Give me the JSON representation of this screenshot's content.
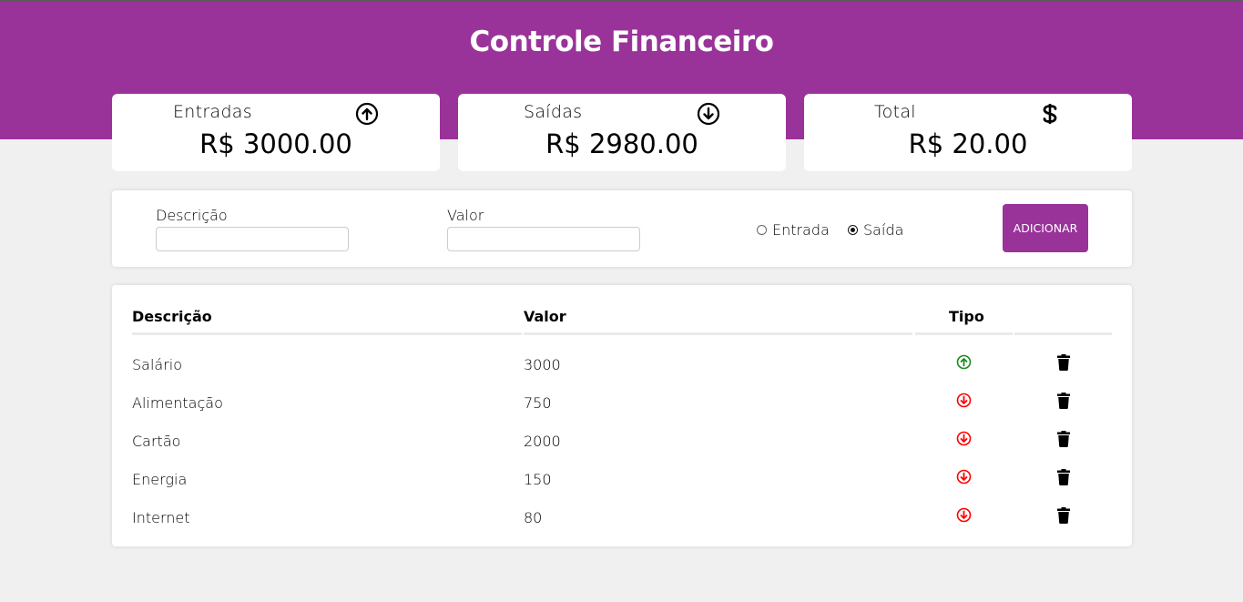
{
  "app": {
    "title": "Controle Financeiro"
  },
  "summary": {
    "entradas": {
      "label": "Entradas",
      "value": "R$ 3000.00",
      "icon": "arrow-up-circle-icon"
    },
    "saidas": {
      "label": "Saídas",
      "value": "R$ 2980.00",
      "icon": "arrow-down-circle-icon"
    },
    "total": {
      "label": "Total",
      "value": "R$ 20.00",
      "icon": "dollar-icon"
    }
  },
  "form": {
    "descricao_label": "Descrição",
    "descricao_value": "",
    "valor_label": "Valor",
    "valor_value": "",
    "radio_entrada": "Entrada",
    "radio_saida": "Saída",
    "selected_type": "Saída",
    "add_button": "ADICIONAR"
  },
  "table": {
    "headers": {
      "descricao": "Descrição",
      "valor": "Valor",
      "tipo": "Tipo"
    },
    "rows": [
      {
        "descricao": "Salário",
        "valor": "3000",
        "tipo": "entrada"
      },
      {
        "descricao": "Alimentação",
        "valor": "750",
        "tipo": "saida"
      },
      {
        "descricao": "Cartão",
        "valor": "2000",
        "tipo": "saida"
      },
      {
        "descricao": "Energia",
        "valor": "150",
        "tipo": "saida"
      },
      {
        "descricao": "Internet",
        "valor": "80",
        "tipo": "saida"
      }
    ]
  },
  "colors": {
    "brand": "#993399",
    "entrada": "#1a8c1a",
    "saida": "#ff0000",
    "background": "#f0f0f0"
  }
}
